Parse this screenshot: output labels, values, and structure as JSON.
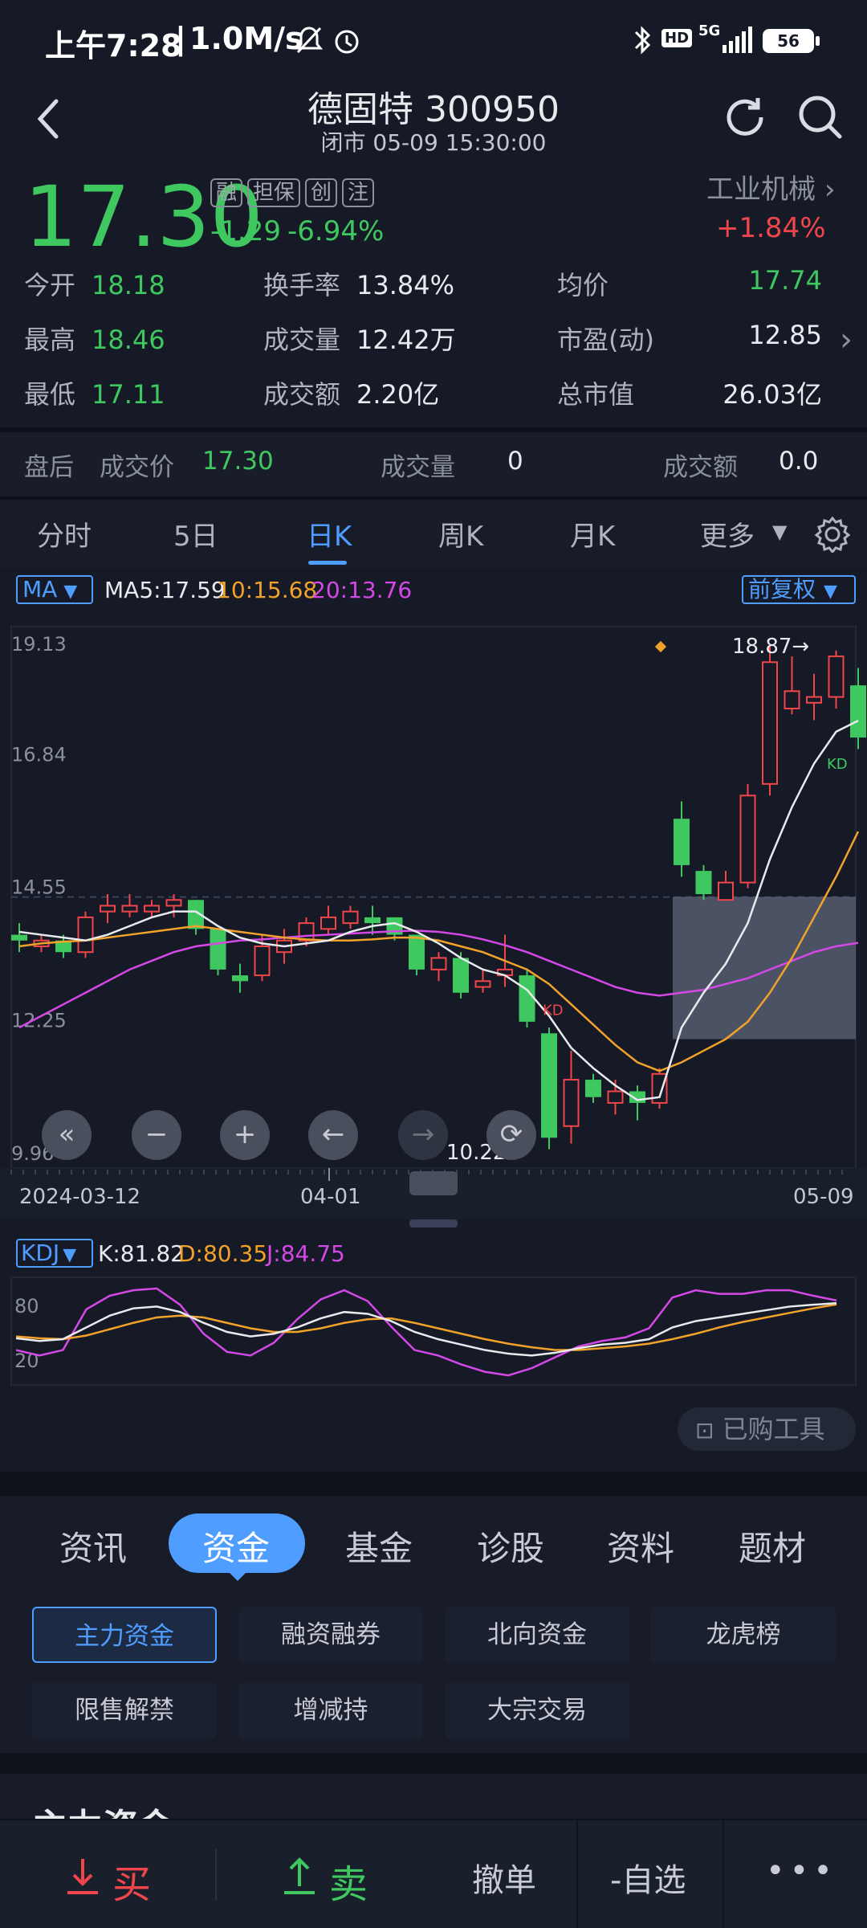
{
  "status_bar": {
    "time": "上午7:28",
    "speed": "1.0M/s",
    "battery": "56",
    "network": "5G",
    "hd": "HD"
  },
  "header": {
    "title": "德固特 300950",
    "subtitle": "闭市 05-09 15:30:00"
  },
  "quote": {
    "price": "17.30",
    "change": "-1.29",
    "change_pct": "-6.94%",
    "tags": [
      "融",
      "担保",
      "创",
      "注"
    ],
    "industry": "工业机械",
    "industry_change": "+1.84%",
    "colors": {
      "down": "#3fc860",
      "up": "#f0464b"
    }
  },
  "stats": [
    [
      {
        "label": "今开",
        "value": "18.18"
      },
      {
        "label": "换手率",
        "value": "13.84%"
      },
      {
        "label": "均价",
        "value": "17.74"
      }
    ],
    [
      {
        "label": "最高",
        "value": "18.46"
      },
      {
        "label": "成交量",
        "value": "12.42万"
      },
      {
        "label": "市盈(动)",
        "value": "12.85"
      }
    ],
    [
      {
        "label": "最低",
        "value": "17.11"
      },
      {
        "label": "成交额",
        "value": "2.20亿"
      },
      {
        "label": "总市值",
        "value": "26.03亿"
      }
    ]
  ],
  "after_hours": {
    "label": "盘后",
    "price_label": "成交价",
    "price": "17.30",
    "volume_label": "成交量",
    "volume": "0",
    "amount_label": "成交额",
    "amount": "0.0"
  },
  "chart_tabs": [
    "分时",
    "5日",
    "日K",
    "周K",
    "月K",
    "更多"
  ],
  "active_chart_tab": "日K",
  "ma_bar": {
    "selector": "MA",
    "ma5": "MA5:17.59",
    "ma10": "10:15.68",
    "ma20": "20:13.76",
    "adjust": "前复权"
  },
  "kdj_bar": {
    "selector": "KDJ",
    "k": "K:81.82",
    "d": "D:80.35",
    "j": "J:84.75"
  },
  "purchased_tools": "已购工具",
  "section_tabs": [
    "资讯",
    "资金",
    "基金",
    "诊股",
    "资料",
    "题材"
  ],
  "active_section_tab": "资金",
  "sub_tabs": [
    "主力资金",
    "融资融券",
    "北向资金",
    "龙虎榜",
    "限售解禁",
    "增减持",
    "大宗交易"
  ],
  "section_heading_partial": "主力资金",
  "bottom_bar": {
    "buy": "买",
    "sell": "卖",
    "cancel": "撤单",
    "watch": "-自选",
    "more": "•••"
  },
  "chart_data": [
    {
      "type": "candlestick",
      "title": "",
      "y_ticks": [
        "19.13",
        "16.84",
        "14.55",
        "12.25",
        "9.96"
      ],
      "ylim": [
        9.96,
        19.13
      ],
      "x_ticks": [
        "2024-03-12",
        "04-01",
        "05-09"
      ],
      "annotations": [
        {
          "text": "18.87→"
        },
        {
          "text": "10.22→"
        }
      ],
      "kd_marker": "KD",
      "candles": [
        {
          "o": 13.9,
          "h": 14.1,
          "l": 13.6,
          "c": 13.8
        },
        {
          "o": 13.7,
          "h": 13.9,
          "l": 13.6,
          "c": 13.8
        },
        {
          "o": 13.8,
          "h": 13.9,
          "l": 13.5,
          "c": 13.6
        },
        {
          "o": 13.6,
          "h": 14.3,
          "l": 13.5,
          "c": 14.2
        },
        {
          "o": 14.3,
          "h": 14.6,
          "l": 14.1,
          "c": 14.4
        },
        {
          "o": 14.3,
          "h": 14.6,
          "l": 14.2,
          "c": 14.4
        },
        {
          "o": 14.3,
          "h": 14.5,
          "l": 14.2,
          "c": 14.4
        },
        {
          "o": 14.4,
          "h": 14.6,
          "l": 14.2,
          "c": 14.5
        },
        {
          "o": 14.5,
          "h": 14.5,
          "l": 13.9,
          "c": 14.0
        },
        {
          "o": 14.0,
          "h": 14.0,
          "l": 13.2,
          "c": 13.3
        },
        {
          "o": 13.2,
          "h": 13.4,
          "l": 12.9,
          "c": 13.1
        },
        {
          "o": 13.2,
          "h": 13.9,
          "l": 13.1,
          "c": 13.7
        },
        {
          "o": 13.6,
          "h": 14.0,
          "l": 13.4,
          "c": 13.8
        },
        {
          "o": 13.8,
          "h": 14.2,
          "l": 13.7,
          "c": 14.1
        },
        {
          "o": 14.0,
          "h": 14.4,
          "l": 13.9,
          "c": 14.2
        },
        {
          "o": 14.1,
          "h": 14.4,
          "l": 14.0,
          "c": 14.3
        },
        {
          "o": 14.2,
          "h": 14.4,
          "l": 13.9,
          "c": 14.1
        },
        {
          "o": 14.2,
          "h": 14.2,
          "l": 13.8,
          "c": 13.9
        },
        {
          "o": 13.9,
          "h": 13.9,
          "l": 13.2,
          "c": 13.3
        },
        {
          "o": 13.3,
          "h": 13.6,
          "l": 13.1,
          "c": 13.5
        },
        {
          "o": 13.5,
          "h": 13.6,
          "l": 12.8,
          "c": 12.9
        },
        {
          "o": 13.0,
          "h": 13.3,
          "l": 12.9,
          "c": 13.1
        },
        {
          "o": 13.2,
          "h": 13.9,
          "l": 13.0,
          "c": 13.3
        },
        {
          "o": 13.2,
          "h": 13.3,
          "l": 12.3,
          "c": 12.4
        },
        {
          "o": 12.2,
          "h": 12.3,
          "l": 10.2,
          "c": 10.4
        },
        {
          "o": 10.6,
          "h": 11.9,
          "l": 10.3,
          "c": 11.4
        },
        {
          "o": 11.4,
          "h": 11.5,
          "l": 11.0,
          "c": 11.1
        },
        {
          "o": 11.0,
          "h": 11.4,
          "l": 10.8,
          "c": 11.2
        },
        {
          "o": 11.2,
          "h": 11.3,
          "l": 10.7,
          "c": 11.0
        },
        {
          "o": 11.0,
          "h": 11.6,
          "l": 10.9,
          "c": 11.5
        },
        {
          "o": 15.9,
          "h": 16.2,
          "l": 14.9,
          "c": 15.1
        },
        {
          "o": 15.0,
          "h": 15.1,
          "l": 14.5,
          "c": 14.6
        },
        {
          "o": 14.5,
          "h": 15.0,
          "l": 14.5,
          "c": 14.8
        },
        {
          "o": 14.8,
          "h": 16.5,
          "l": 14.7,
          "c": 16.3
        },
        {
          "o": 16.5,
          "h": 18.9,
          "l": 16.3,
          "c": 18.6
        },
        {
          "o": 17.8,
          "h": 18.7,
          "l": 17.7,
          "c": 18.1
        },
        {
          "o": 17.9,
          "h": 18.4,
          "l": 17.6,
          "c": 18.0
        },
        {
          "o": 18.0,
          "h": 18.8,
          "l": 17.8,
          "c": 18.7
        },
        {
          "o": 18.2,
          "h": 18.5,
          "l": 17.1,
          "c": 17.3
        }
      ],
      "ma5": [
        13.95,
        13.9,
        13.85,
        13.8,
        13.9,
        14.05,
        14.2,
        14.3,
        14.3,
        14.05,
        13.85,
        13.75,
        13.7,
        13.75,
        13.8,
        13.95,
        14.05,
        14.1,
        13.95,
        13.75,
        13.5,
        13.3,
        13.2,
        12.95,
        12.5,
        11.95,
        11.6,
        11.3,
        11.05,
        11.1,
        12.3,
        12.9,
        13.4,
        14.1,
        15.2,
        16.1,
        16.85,
        17.4,
        17.59
      ],
      "ma10": [
        13.7,
        13.75,
        13.78,
        13.8,
        13.85,
        13.9,
        13.95,
        14.0,
        14.05,
        14.0,
        13.95,
        13.9,
        13.85,
        13.82,
        13.8,
        13.8,
        13.82,
        13.85,
        13.85,
        13.8,
        13.7,
        13.6,
        13.45,
        13.3,
        13.05,
        12.7,
        12.35,
        12.0,
        11.7,
        11.55,
        11.7,
        11.9,
        12.1,
        12.4,
        12.9,
        13.5,
        14.2,
        14.9,
        15.68
      ],
      "ma20": [
        12.3,
        12.5,
        12.7,
        12.9,
        13.1,
        13.3,
        13.45,
        13.6,
        13.7,
        13.75,
        13.8,
        13.82,
        13.85,
        13.88,
        13.9,
        13.92,
        13.94,
        13.96,
        13.97,
        13.95,
        13.9,
        13.82,
        13.72,
        13.6,
        13.45,
        13.3,
        13.15,
        13.0,
        12.9,
        12.85,
        12.9,
        12.95,
        13.05,
        13.15,
        13.3,
        13.45,
        13.6,
        13.7,
        13.76
      ]
    },
    {
      "type": "line",
      "title": "",
      "y_ticks": [
        "80",
        "20"
      ],
      "ylim": [
        -5,
        105
      ],
      "series": [
        {
          "name": "K",
          "values": [
            43,
            40,
            42,
            55,
            68,
            76,
            78,
            72,
            60,
            50,
            45,
            48,
            55,
            65,
            72,
            70,
            62,
            50,
            42,
            36,
            30,
            26,
            24,
            27,
            32,
            36,
            38,
            42,
            55,
            62,
            66,
            70,
            74,
            78,
            80,
            81.82
          ]
        },
        {
          "name": "D",
          "values": [
            45,
            43,
            42,
            46,
            53,
            60,
            66,
            68,
            66,
            60,
            54,
            50,
            50,
            54,
            60,
            64,
            65,
            60,
            54,
            48,
            42,
            37,
            33,
            30,
            30,
            32,
            34,
            37,
            42,
            48,
            55,
            61,
            66,
            71,
            76,
            80.35
          ]
        },
        {
          "name": "J",
          "values": [
            30,
            24,
            30,
            75,
            90,
            96,
            98,
            80,
            48,
            28,
            24,
            38,
            64,
            86,
            96,
            84,
            56,
            30,
            24,
            14,
            6,
            2,
            10,
            22,
            34,
            40,
            44,
            54,
            88,
            96,
            92,
            92,
            96,
            96,
            90,
            84.75
          ]
        }
      ]
    }
  ]
}
